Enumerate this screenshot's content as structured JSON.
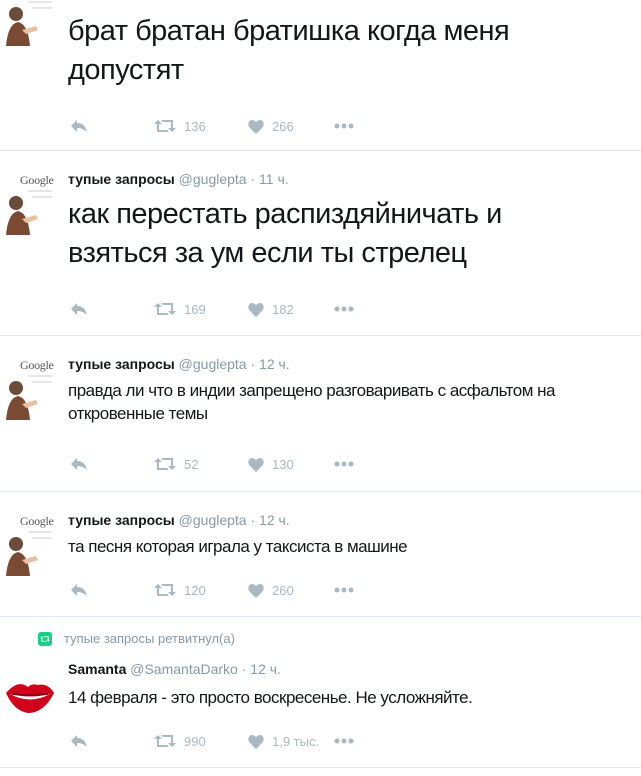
{
  "colors": {
    "text": "#14171a",
    "muted": "#8899a6",
    "icon": "#aab8c2",
    "divider": "#e1e8ed",
    "retweet_green": "#19cf86",
    "lips_red": "#d0021b"
  },
  "tweets": [
    {
      "text": "брат братан братишка когда меня допустят",
      "retweets": "136",
      "likes": "266"
    },
    {
      "logo": "Google",
      "name": "тупые запросы",
      "handle": "@guglepta",
      "time": "· 11 ч.",
      "text": "как перестать распиздяйничать и взяться за ум если ты стрелец",
      "retweets": "169",
      "likes": "182"
    },
    {
      "logo": "Google",
      "name": "тупые запросы",
      "handle": "@guglepta",
      "time": "· 12 ч.",
      "text": "правда ли что в индии запрещено разговаривать с асфальтом на откровенные темы",
      "retweets": "52",
      "likes": "130"
    },
    {
      "logo": "Google",
      "name": "тупые запросы",
      "handle": "@guglepta",
      "time": "· 12 ч.",
      "text": "та песня которая играла у таксиста в машине",
      "retweets": "120",
      "likes": "260"
    },
    {
      "retweeted_by": "тупые запросы ретвитнул(а)",
      "name": "Samanta",
      "handle": "@SamantaDarko",
      "time": "· 12 ч.",
      "text": "14 февраля - это просто воскресенье. Не усложняйте.",
      "retweets": "990",
      "likes": "1,9 тыс."
    }
  ],
  "icons": {
    "reply": "reply-icon",
    "retweet": "retweet-icon",
    "like": "heart-icon",
    "more": "more-icon"
  }
}
